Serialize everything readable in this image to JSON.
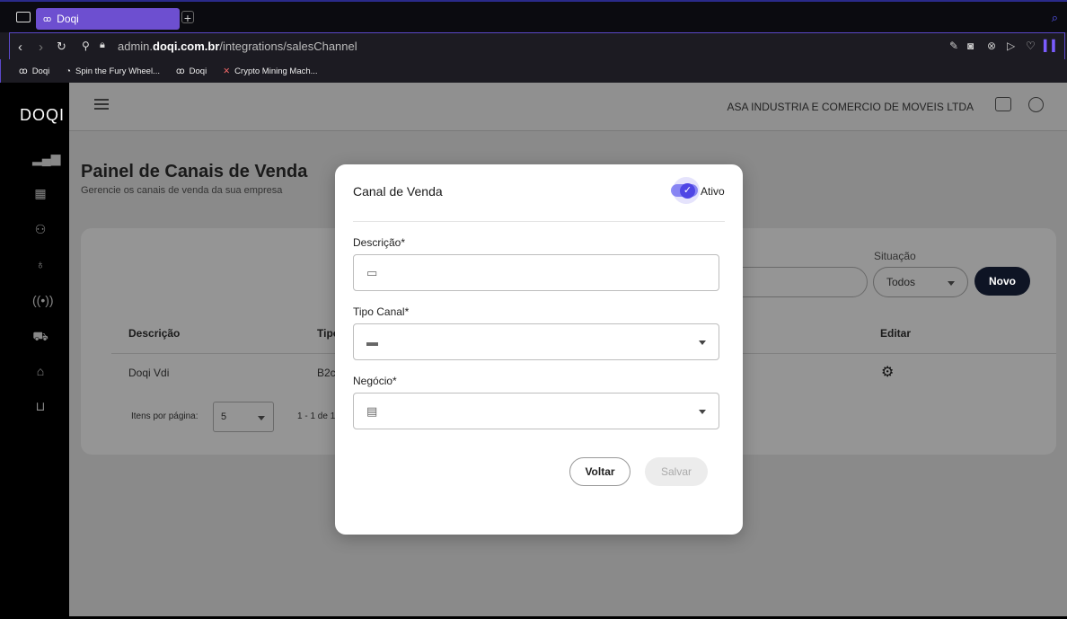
{
  "browser": {
    "tab_title": "Doqi",
    "new_tab": "+",
    "url_prefix": "admin.",
    "url_domain": "doqi.com.br",
    "url_path": "/integrations/salesChannel",
    "bookmarks": [
      "Doqi",
      "Spin the Fury Wheel...",
      "Doqi",
      "Crypto Mining Mach..."
    ]
  },
  "app": {
    "logo": "DOQI",
    "company": "ASA INDUSTRIA E COMERCIO DE MOVEIS LTDA",
    "page_title": "Painel de Canais de Venda",
    "page_subtitle": "Gerencie os canais de venda da sua empresa",
    "filter_label": "Situação",
    "filter_value": "Todos",
    "new_button": "Novo",
    "table": {
      "headers": [
        "Descrição",
        "Tipo",
        "Editar"
      ],
      "rows": [
        {
          "descricao": "Doqi Vdi",
          "tipo": "B2c"
        }
      ]
    },
    "pagination": {
      "label": "Itens por página:",
      "per_page": "5",
      "range": "1 - 1 de 1"
    }
  },
  "modal": {
    "title": "Canal de Venda",
    "toggle_label": "Ativo",
    "toggle_on": true,
    "fields": [
      {
        "label": "Descrição*",
        "value": ""
      },
      {
        "label": "Tipo Canal*",
        "value": ""
      },
      {
        "label": "Negócio*",
        "value": ""
      }
    ],
    "back_button": "Voltar",
    "save_button": "Salvar"
  },
  "colors": {
    "accent": "#4f46e5",
    "tab": "#6d4fd0",
    "primary_button": "#0e1424"
  }
}
